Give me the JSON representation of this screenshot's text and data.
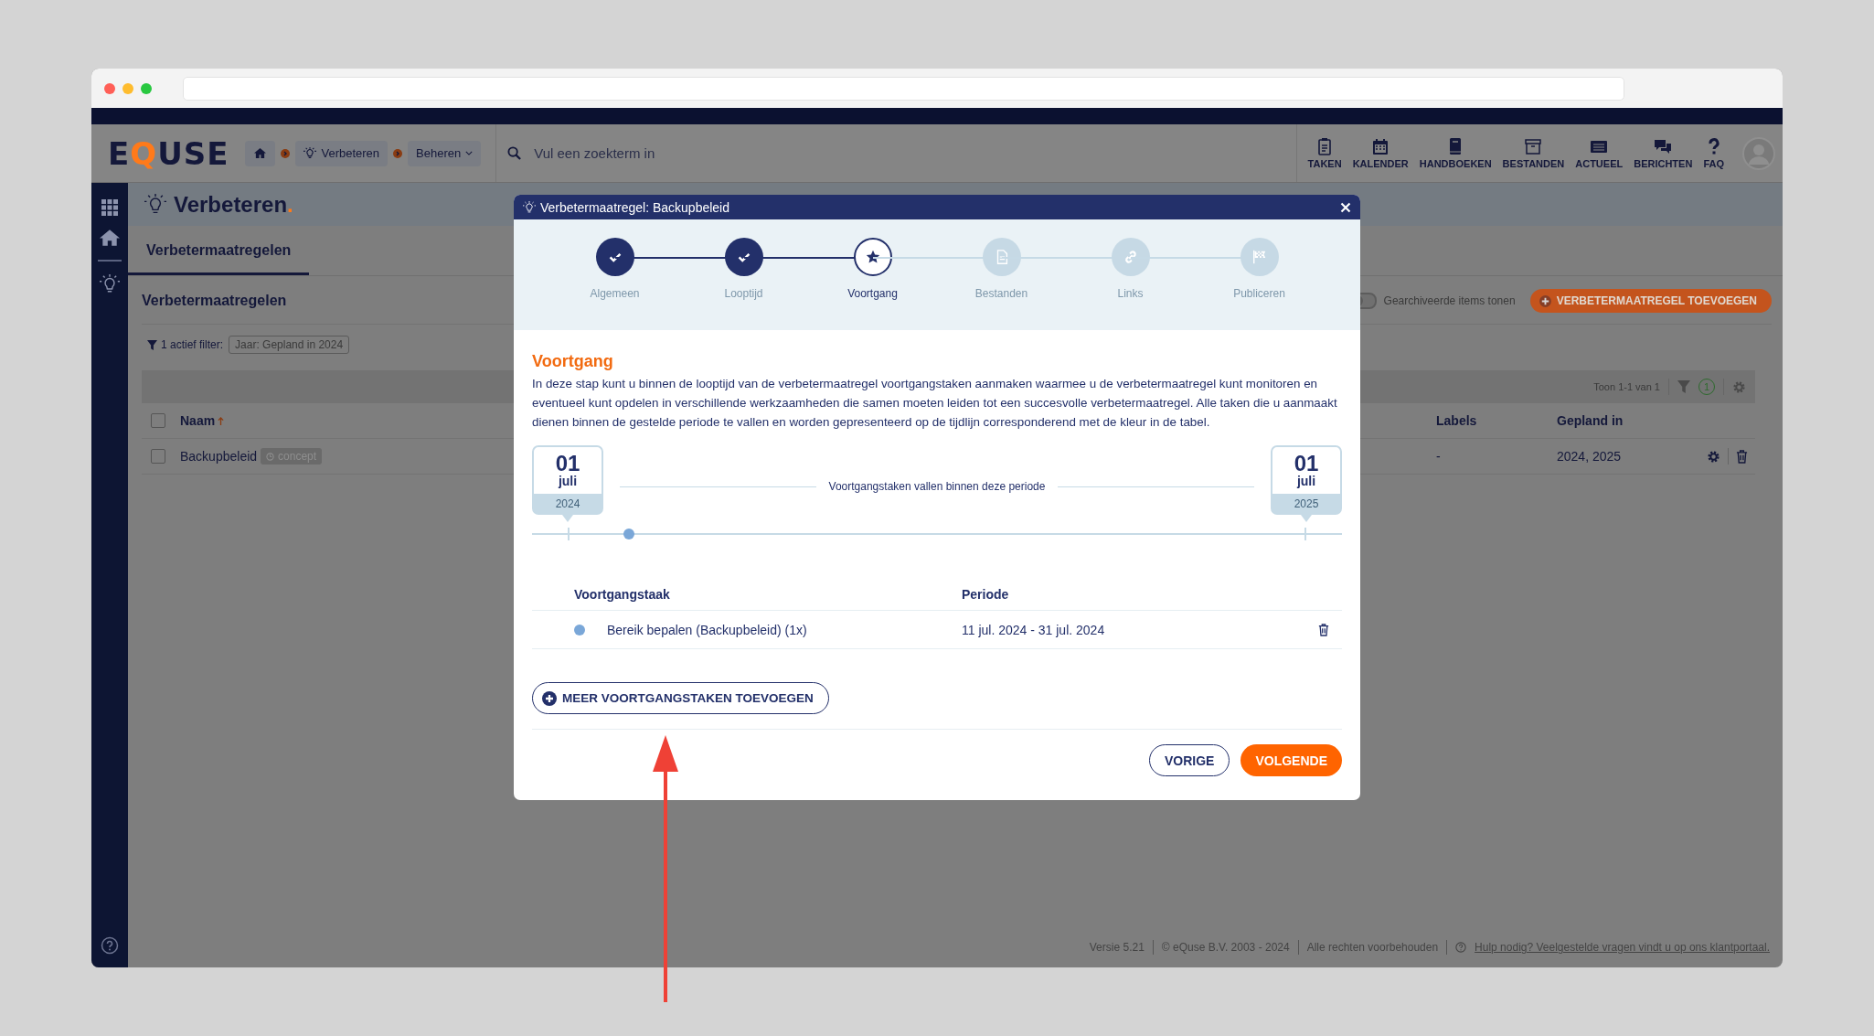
{
  "header": {
    "logo": [
      {
        "text": "E",
        "accent": false
      },
      {
        "text": "Q",
        "accent": true
      },
      {
        "text": "USE",
        "accent": false
      }
    ],
    "breadcrumb": [
      {
        "kind": "home"
      },
      {
        "kind": "crumb",
        "label": "Verbeteren"
      },
      {
        "kind": "dropdown",
        "label": "Beheren"
      }
    ],
    "search": {
      "placeholder": "Vul een zoekterm in"
    },
    "nav": [
      {
        "kind": "clipboard",
        "label": "TAKEN"
      },
      {
        "kind": "calendar",
        "label": "KALENDER"
      },
      {
        "kind": "book",
        "label": "HANDBOEKEN"
      },
      {
        "kind": "archive",
        "label": "BESTANDEN"
      },
      {
        "kind": "news",
        "label": "ACTUEEL"
      },
      {
        "kind": "chat",
        "label": "BERICHTEN"
      },
      {
        "kind": "question",
        "label": "FAQ"
      }
    ]
  },
  "page": {
    "title": "Verbeteren",
    "title_suffix": ".",
    "tabs": [
      {
        "label": "Verbetermaatregelen",
        "selected": true
      }
    ],
    "section_title": "Verbetermaatregelen",
    "archive_toggle": {
      "label": "Gearchiveerde items tonen",
      "on": false
    },
    "add_button": "VERBETERMAATREGEL TOEVOEGEN",
    "filter": {
      "label": "1 actief filter:",
      "chip": "Jaar: Gepland in 2024"
    },
    "table": {
      "count": "Toon 1-1 van 1",
      "filter_badge": "1",
      "all_checked": false,
      "columns": [
        "Naam",
        "Labels",
        "Gepland in"
      ],
      "rows": [
        {
          "checked": false,
          "naam": "Backupbeleid",
          "status": "concept",
          "labels": "-",
          "gepland_in": "2024, 2025"
        }
      ]
    }
  },
  "footer": {
    "version": "Versie 5.21",
    "copyright": "© eQuse B.V. 2003 - 2024",
    "rights": "Alle rechten voorbehouden",
    "help_link": "Hulp nodig? Veelgestelde vragen vindt u op ons klantportaal."
  },
  "modal": {
    "title": "Verbetermaatregel: Backupbeleid",
    "steps": [
      {
        "kind": "check",
        "label": "Algemeen",
        "completed": true,
        "selected": false
      },
      {
        "kind": "check",
        "label": "Looptijd",
        "completed": true,
        "selected": false
      },
      {
        "kind": "star",
        "label": "Voortgang",
        "completed": false,
        "selected": true
      },
      {
        "kind": "file",
        "label": "Bestanden",
        "completed": false,
        "selected": false
      },
      {
        "kind": "link",
        "label": "Links",
        "completed": false,
        "selected": false
      },
      {
        "kind": "flag",
        "label": "Publiceren",
        "completed": false,
        "selected": false
      }
    ],
    "heading": "Voortgang",
    "description": "In deze stap kunt u binnen de looptijd van de verbetermaatregel voortgangstaken aanmaken waarmee u de verbetermaatregel kunt monitoren en eventueel kunt opdelen in verschillende werkzaamheden die samen moeten leiden tot een succesvolle verbetermaatregel. Alle taken die u aanmaakt dienen binnen de gestelde periode te vallen en worden gepresenteerd op de tijdlijn corresponderend met de kleur in de tabel.",
    "timeline": {
      "start": {
        "day": "01",
        "month": "juli",
        "year": "2024"
      },
      "end": {
        "day": "01",
        "month": "juli",
        "year": "2025"
      },
      "caption": "Voortgangstaken vallen binnen deze periode"
    },
    "columns": [
      "Voortgangstaak",
      "Periode"
    ],
    "tasks": [
      {
        "name": "Bereik bepalen (Backupbeleid) (1x)",
        "period": "11 jul. 2024 - 31 jul. 2024",
        "color": "#7aa7d8"
      }
    ],
    "add_button": "MEER VOORTGANGSTAKEN TOEVOEGEN",
    "prev_button": "VORIGE",
    "next_button": "VOLGENDE"
  }
}
